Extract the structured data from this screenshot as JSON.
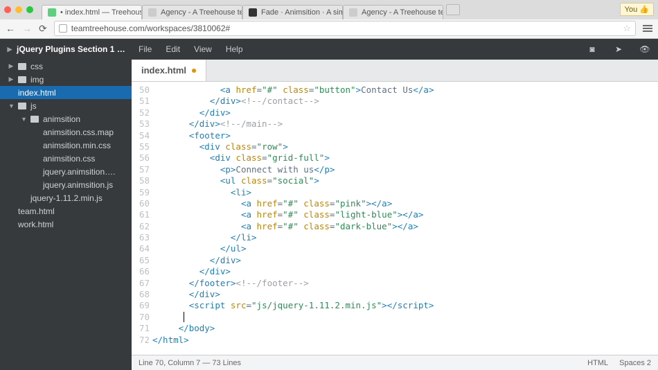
{
  "browser": {
    "tabs": [
      {
        "title": "• index.html — Treehouse",
        "icon": "#5fcf80"
      },
      {
        "title": "Agency - A Treehouse tem…",
        "icon": "#cccccc"
      },
      {
        "title": "Fade · Animsition · A simp…",
        "icon": "#333333"
      },
      {
        "title": "Agency - A Treehouse tem…",
        "icon": "#cccccc"
      }
    ],
    "user": "You ",
    "url": "teamtreehouse.com/workspaces/3810062#"
  },
  "sidebar": {
    "project": "jQuery Plugins Section 1 …",
    "items": [
      {
        "type": "folder",
        "label": "css",
        "indent": 0,
        "open": false
      },
      {
        "type": "folder",
        "label": "img",
        "indent": 0,
        "open": false
      },
      {
        "type": "file",
        "label": "index.html",
        "indent": 0,
        "selected": true
      },
      {
        "type": "folder",
        "label": "js",
        "indent": 0,
        "open": true
      },
      {
        "type": "folder",
        "label": "animsition",
        "indent": 1,
        "open": true
      },
      {
        "type": "file",
        "label": "animsition.css.map",
        "indent": 2
      },
      {
        "type": "file",
        "label": "animsition.min.css",
        "indent": 2
      },
      {
        "type": "file",
        "label": "animsition.css",
        "indent": 2
      },
      {
        "type": "file",
        "label": "jquery.animsition….",
        "indent": 2
      },
      {
        "type": "file",
        "label": "jquery.animsition.js",
        "indent": 2
      },
      {
        "type": "file",
        "label": "jquery-1.11.2.min.js",
        "indent": 1
      },
      {
        "type": "file",
        "label": "team.html",
        "indent": 0
      },
      {
        "type": "file",
        "label": "work.html",
        "indent": 0
      }
    ]
  },
  "menus": {
    "file": "File",
    "edit": "Edit",
    "view": "View",
    "help": "Help"
  },
  "doc_tab": "index.html",
  "code": {
    "first_line": 50,
    "lines": [
      {
        "html": "             <span class='t-tag'>&lt;a</span> <span class='t-attr'>href</span>=<span class='t-str'>\"#\"</span> <span class='t-attr'>class</span>=<span class='t-str'>\"button\"</span><span class='t-tag'>&gt;</span><span class='t-text'>Contact Us</span><span class='t-tag'>&lt;/a&gt;</span>"
      },
      {
        "html": "           <span class='t-tag'>&lt;/div&gt;</span><span class='t-cmt'>&lt;!--/contact--&gt;</span>"
      },
      {
        "html": "         <span class='t-tag'>&lt;/div&gt;</span>"
      },
      {
        "html": "       <span class='t-tag'>&lt;/div&gt;</span><span class='t-cmt'>&lt;!--/main--&gt;</span>"
      },
      {
        "html": "       <span class='t-tag'>&lt;footer&gt;</span>"
      },
      {
        "html": "         <span class='t-tag'>&lt;div</span> <span class='t-attr'>class</span>=<span class='t-str'>\"row\"</span><span class='t-tag'>&gt;</span>"
      },
      {
        "html": "           <span class='t-tag'>&lt;div</span> <span class='t-attr'>class</span>=<span class='t-str'>\"grid-full\"</span><span class='t-tag'>&gt;</span>"
      },
      {
        "html": "             <span class='t-tag'>&lt;p&gt;</span><span class='t-text'>Connect with us</span><span class='t-tag'>&lt;/p&gt;</span>"
      },
      {
        "html": "             <span class='t-tag'>&lt;ul</span> <span class='t-attr'>class</span>=<span class='t-str'>\"social\"</span><span class='t-tag'>&gt;</span>"
      },
      {
        "html": "               <span class='t-tag'>&lt;li&gt;</span>"
      },
      {
        "html": "                 <span class='t-tag'>&lt;a</span> <span class='t-attr'>href</span>=<span class='t-str'>\"#\"</span> <span class='t-attr'>class</span>=<span class='t-str'>\"pink\"</span><span class='t-tag'>&gt;&lt;/a&gt;</span>"
      },
      {
        "html": "                 <span class='t-tag'>&lt;a</span> <span class='t-attr'>href</span>=<span class='t-str'>\"#\"</span> <span class='t-attr'>class</span>=<span class='t-str'>\"light-blue\"</span><span class='t-tag'>&gt;&lt;/a&gt;</span>"
      },
      {
        "html": "                 <span class='t-tag'>&lt;a</span> <span class='t-attr'>href</span>=<span class='t-str'>\"#\"</span> <span class='t-attr'>class</span>=<span class='t-str'>\"dark-blue\"</span><span class='t-tag'>&gt;&lt;/a&gt;</span>"
      },
      {
        "html": "               <span class='t-tag'>&lt;/li&gt;</span>"
      },
      {
        "html": "             <span class='t-tag'>&lt;/ul&gt;</span>"
      },
      {
        "html": "           <span class='t-tag'>&lt;/div&gt;</span>"
      },
      {
        "html": "         <span class='t-tag'>&lt;/div&gt;</span>"
      },
      {
        "html": "       <span class='t-tag'>&lt;/footer&gt;</span><span class='t-cmt'>&lt;!--/footer--&gt;</span>"
      },
      {
        "html": "       <span class='t-tag'>&lt;/div&gt;</span>"
      },
      {
        "html": "       <span class='t-tag'>&lt;script</span> <span class='t-attr'>src</span>=<span class='t-str'>\"js/jquery-1.11.2.min.js\"</span><span class='t-tag'>&gt;&lt;/script&gt;</span>"
      },
      {
        "html": "      <span class='cursor'></span>"
      },
      {
        "html": "     <span class='t-tag'>&lt;/body&gt;</span>"
      },
      {
        "html": "<span class='t-tag'>&lt;/html&gt;</span>"
      }
    ]
  },
  "status": {
    "pos": "Line 70, Column 7 — 73 Lines",
    "lang": "HTML",
    "spaces": "Spaces  2"
  }
}
